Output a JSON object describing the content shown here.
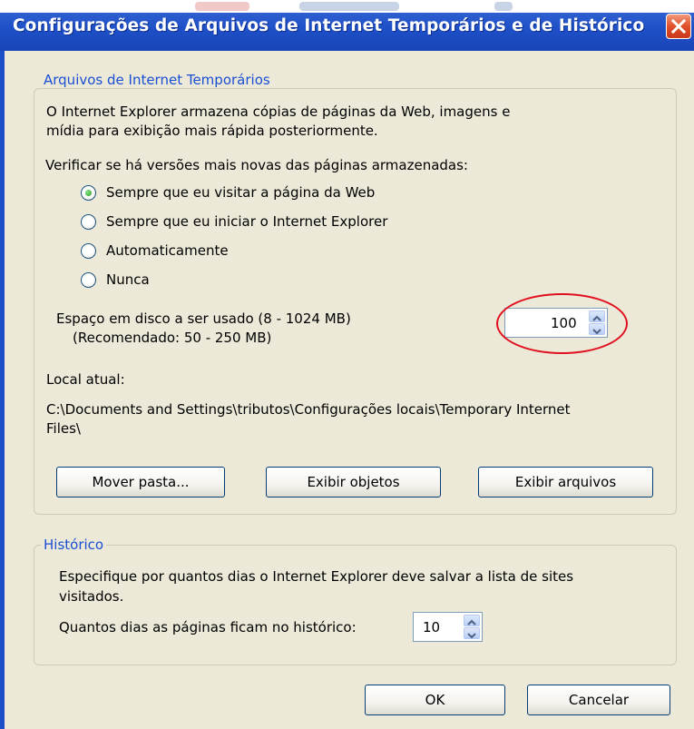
{
  "window": {
    "title": "Configurações de Arquivos de Internet Temporários e de Histórico",
    "close_icon": "close-icon",
    "colors": {
      "titlebar": "#1e50c8",
      "close": "#e0502b",
      "dialog_bg": "#ece9d8",
      "legend": "#1a4fd3",
      "highlight": "#e0101e"
    }
  },
  "temp_files": {
    "legend": "Arquivos de Internet Temporários",
    "description_line1": "O Internet Explorer armazena cópias de páginas da Web, imagens e",
    "description_line2": "mídia para exibição mais rápida posteriormente.",
    "check_label": "Verificar se há versões mais novas das páginas armazenadas:",
    "options": [
      {
        "label": "Sempre que eu visitar a página da Web",
        "selected": true
      },
      {
        "label": "Sempre que eu iniciar o Internet Explorer",
        "selected": false
      },
      {
        "label": "Automaticamente",
        "selected": false
      },
      {
        "label": "Nunca",
        "selected": false
      }
    ],
    "disk_label": "Espaço em disco a ser usado (8 - 1024 MB)",
    "disk_recommended": "(Recomendado: 50 - 250 MB)",
    "disk_value": "100",
    "location_label": "Local atual:",
    "location_path_line1": "C:\\Documents and Settings\\tributos\\Configurações locais\\Temporary Internet",
    "location_path_line2": "Files\\",
    "buttons": {
      "move": "Mover pasta...",
      "view_objects": "Exibir objetos",
      "view_files": "Exibir arquivos"
    }
  },
  "history": {
    "legend": "Histórico",
    "description_line1": "Especifique por quantos dias o Internet Explorer deve salvar a lista de sites",
    "description_line2": "visitados.",
    "days_label": "Quantos dias as páginas ficam no histórico:",
    "days_value": "10"
  },
  "footer": {
    "ok": "OK",
    "cancel": "Cancelar"
  }
}
